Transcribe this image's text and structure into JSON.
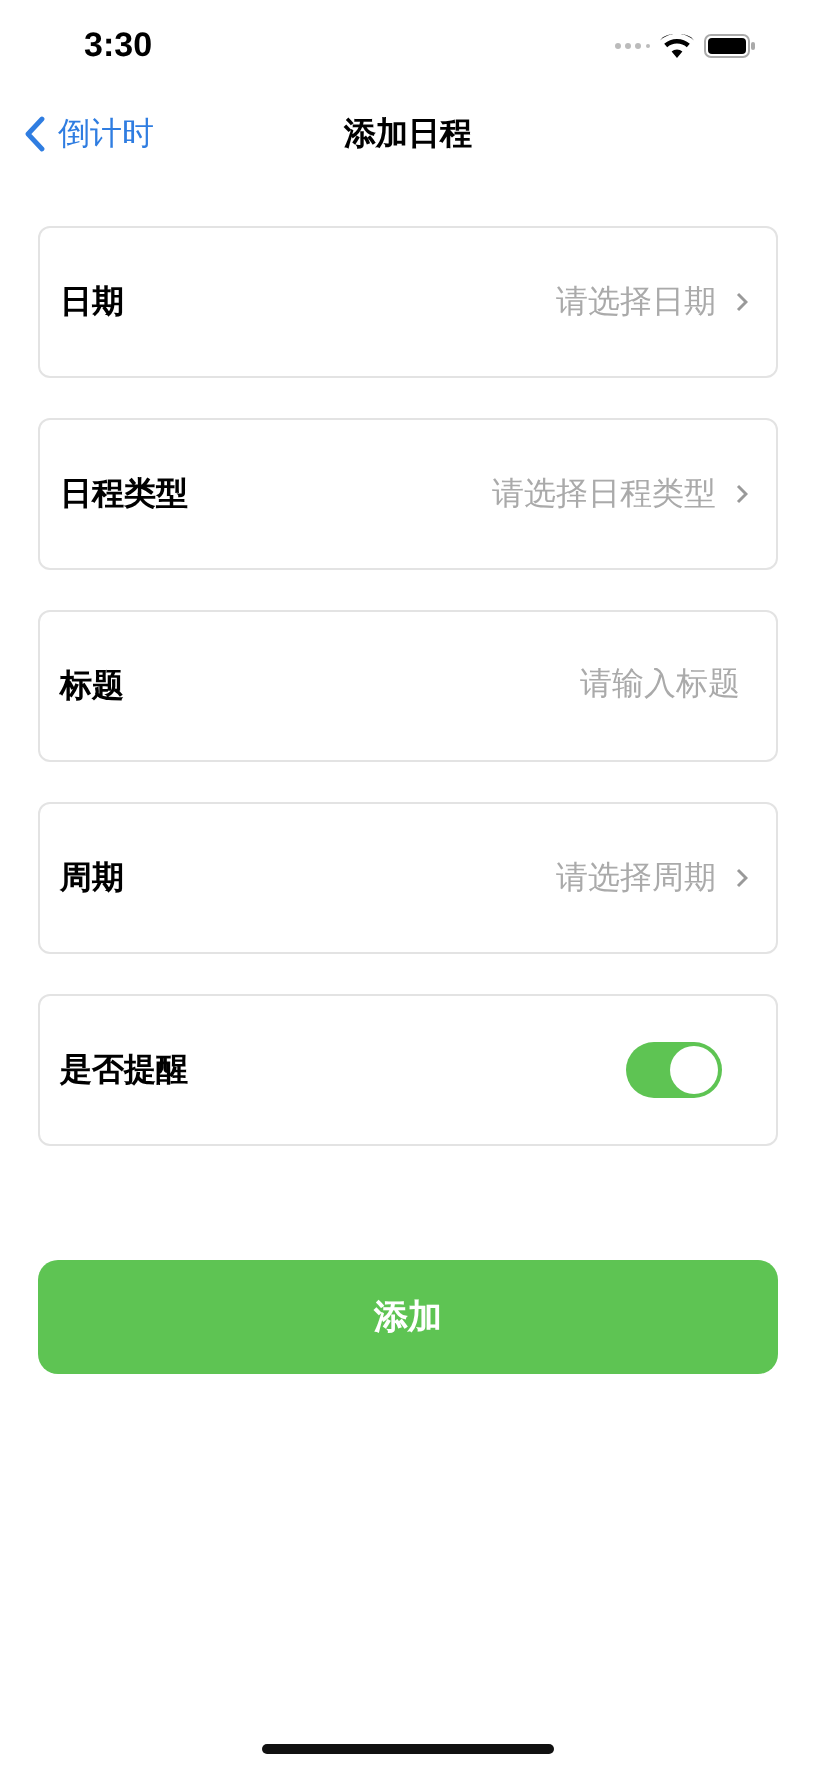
{
  "status_bar": {
    "time": "3:30"
  },
  "nav": {
    "back_label": "倒计时",
    "title": "添加日程"
  },
  "rows": [
    {
      "kind": "select",
      "label": "日期",
      "placeholder": "请选择日期"
    },
    {
      "kind": "select",
      "label": "日程类型",
      "placeholder": "请选择日程类型"
    },
    {
      "kind": "input",
      "label": "标题",
      "placeholder": "请输入标题"
    },
    {
      "kind": "select",
      "label": "周期",
      "placeholder": "请选择周期"
    },
    {
      "kind": "toggle",
      "label": "是否提醒",
      "on": true
    }
  ],
  "submit_button": "添加"
}
